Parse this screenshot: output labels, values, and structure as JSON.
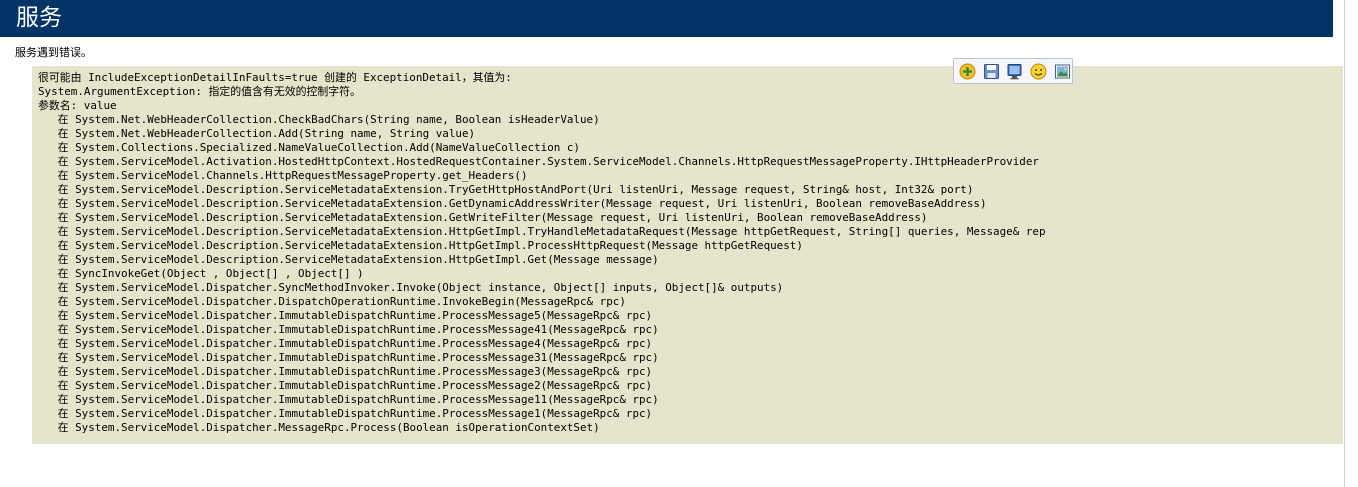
{
  "header": {
    "title": "服务"
  },
  "intro": {
    "text": "服务遇到错误。"
  },
  "error": {
    "lines": [
      "很可能由 IncludeExceptionDetailInFaults=true 创建的 ExceptionDetail，其值为:",
      "System.ArgumentException: 指定的值含有无效的控制字符。",
      "参数名: value",
      "   在 System.Net.WebHeaderCollection.CheckBadChars(String name, Boolean isHeaderValue)",
      "   在 System.Net.WebHeaderCollection.Add(String name, String value)",
      "   在 System.Collections.Specialized.NameValueCollection.Add(NameValueCollection c)",
      "   在 System.ServiceModel.Activation.HostedHttpContext.HostedRequestContainer.System.ServiceModel.Channels.HttpRequestMessageProperty.IHttpHeaderProvider",
      "   在 System.ServiceModel.Channels.HttpRequestMessageProperty.get_Headers()",
      "   在 System.ServiceModel.Description.ServiceMetadataExtension.TryGetHttpHostAndPort(Uri listenUri, Message request, String& host, Int32& port)",
      "   在 System.ServiceModel.Description.ServiceMetadataExtension.GetDynamicAddressWriter(Message request, Uri listenUri, Boolean removeBaseAddress)",
      "   在 System.ServiceModel.Description.ServiceMetadataExtension.GetWriteFilter(Message request, Uri listenUri, Boolean removeBaseAddress)",
      "   在 System.ServiceModel.Description.ServiceMetadataExtension.HttpGetImpl.TryHandleMetadataRequest(Message httpGetRequest, String[] queries, Message& rep",
      "   在 System.ServiceModel.Description.ServiceMetadataExtension.HttpGetImpl.ProcessHttpRequest(Message httpGetRequest)",
      "   在 System.ServiceModel.Description.ServiceMetadataExtension.HttpGetImpl.Get(Message message)",
      "   在 SyncInvokeGet(Object , Object[] , Object[] )",
      "   在 System.ServiceModel.Dispatcher.SyncMethodInvoker.Invoke(Object instance, Object[] inputs, Object[]& outputs)",
      "   在 System.ServiceModel.Dispatcher.DispatchOperationRuntime.InvokeBegin(MessageRpc& rpc)",
      "   在 System.ServiceModel.Dispatcher.ImmutableDispatchRuntime.ProcessMessage5(MessageRpc& rpc)",
      "   在 System.ServiceModel.Dispatcher.ImmutableDispatchRuntime.ProcessMessage41(MessageRpc& rpc)",
      "   在 System.ServiceModel.Dispatcher.ImmutableDispatchRuntime.ProcessMessage4(MessageRpc& rpc)",
      "   在 System.ServiceModel.Dispatcher.ImmutableDispatchRuntime.ProcessMessage31(MessageRpc& rpc)",
      "   在 System.ServiceModel.Dispatcher.ImmutableDispatchRuntime.ProcessMessage3(MessageRpc& rpc)",
      "   在 System.ServiceModel.Dispatcher.ImmutableDispatchRuntime.ProcessMessage2(MessageRpc& rpc)",
      "   在 System.ServiceModel.Dispatcher.ImmutableDispatchRuntime.ProcessMessage11(MessageRpc& rpc)",
      "   在 System.ServiceModel.Dispatcher.ImmutableDispatchRuntime.ProcessMessage1(MessageRpc& rpc)",
      "   在 System.ServiceModel.Dispatcher.MessageRpc.Process(Boolean isOperationContextSet)"
    ]
  },
  "toolbar": {
    "icons": [
      "add-icon",
      "save-icon",
      "monitor-icon",
      "smiley-icon",
      "image-icon"
    ]
  },
  "colors": {
    "header_bg": "#003366",
    "header_text": "#ffffff",
    "error_bg": "#e5e5cc",
    "text": "#000000"
  }
}
